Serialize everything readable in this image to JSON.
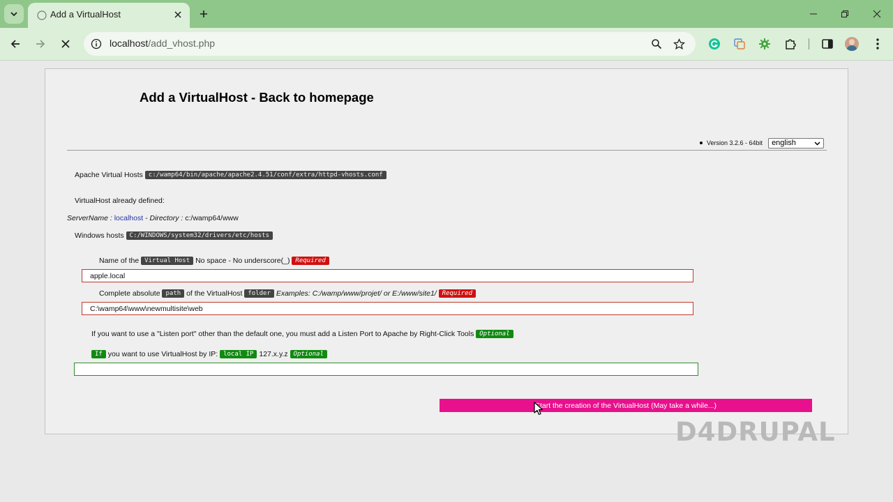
{
  "browser": {
    "tab_title": "Add a VirtualHost",
    "url_host": "localhost",
    "url_path": "/add_vhost.php",
    "accent": "#8fc78a"
  },
  "page": {
    "title": "Add a VirtualHost - Back to homepage",
    "version": "Version 3.2.6 - 64bit",
    "language_selected": "english",
    "apache_vhosts_label": "Apache Virtual Hosts",
    "apache_vhosts_path": "c:/wamp64/bin/apache/apache2.4.51/conf/extra/httpd-vhosts.conf",
    "already_defined_label": "VirtualHost already defined:",
    "server_name_label": "ServerName :",
    "server_name_value": "localhost",
    "directory_label": "- Directory :",
    "directory_value": "c:/wamp64/www",
    "windows_hosts_label": "Windows hosts",
    "windows_hosts_path": "C:/WINDOWS/system32/drivers/etc/hosts",
    "name_label_pre": "Name of the",
    "name_label_code": "Virtual Host",
    "name_label_post": "No space - No underscore(_)",
    "required": "Required",
    "name_value": "apple.local",
    "path_label_pre": "Complete absolute",
    "path_label_code": "path",
    "path_label_mid": "of the VirtualHost",
    "path_label_code2": "folder",
    "path_examples": "Examples: C:/wamp/www/projet/ or E:/www/site1/",
    "path_value": "C:\\wamp64\\www\\newmultisite\\web",
    "listen_port_text": "If you want to use a \"Listen port\" other than the default one, you must add a Listen Port to Apache by Right-Click Tools",
    "optional": "Optional",
    "ip_if": "If",
    "ip_text": "you want to use VirtualHost by IP:",
    "ip_code": "local IP",
    "ip_example": "127.x.y.z",
    "ip_value": "",
    "submit_label": "Start the creation of the VirtualHost (May take a while...)"
  },
  "watermark": "D4DRUPAL",
  "colors": {
    "submit": "#e8108c",
    "required": "#d01010",
    "optional": "#118a11"
  }
}
